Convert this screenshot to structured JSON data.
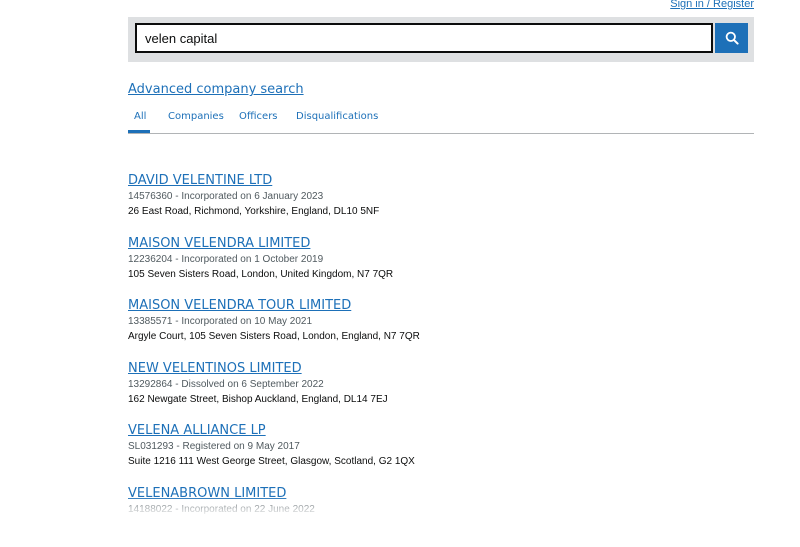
{
  "header": {
    "signin_label": "Sign in / Register"
  },
  "search": {
    "value": "velen capital",
    "button_icon": "search-icon"
  },
  "advanced_search_label": "Advanced company search",
  "tabs": [
    {
      "label": "All",
      "active": true
    },
    {
      "label": "Companies",
      "active": false
    },
    {
      "label": "Officers",
      "active": false
    },
    {
      "label": "Disqualifications",
      "active": false
    }
  ],
  "results": [
    {
      "title": "DAVID VELENTINE LTD",
      "meta": "14576360 - Incorporated on 6 January 2023",
      "address": "26 East Road, Richmond, Yorkshire, England, DL10 5NF"
    },
    {
      "title": "MAISON VELENDRA LIMITED",
      "meta": "12236204 - Incorporated on 1 October 2019",
      "address": "105 Seven Sisters Road, London, United Kingdom, N7 7QR"
    },
    {
      "title": "MAISON VELENDRA TOUR LIMITED",
      "meta": "13385571 - Incorporated on 10 May 2021",
      "address": "Argyle Court, 105 Seven Sisters Road, London, England, N7 7QR"
    },
    {
      "title": "NEW VELENTINOS LIMITED",
      "meta": "13292864 - Dissolved on 6 September 2022",
      "address": "162 Newgate Street, Bishop Auckland, England, DL14 7EJ"
    },
    {
      "title": "VELENA ALLIANCE LP",
      "meta": "SL031293 - Registered on 9 May 2017",
      "address": "Suite 1216 111 West George Street, Glasgow, Scotland, G2 1QX"
    },
    {
      "title": "VELENABROWN LIMITED",
      "meta": "14188022 - Incorporated on 22 June 2022",
      "address": ""
    }
  ],
  "colors": {
    "link": "#1d70b8",
    "search_panel": "#dee0e2",
    "search_button": "#1d70b8"
  }
}
